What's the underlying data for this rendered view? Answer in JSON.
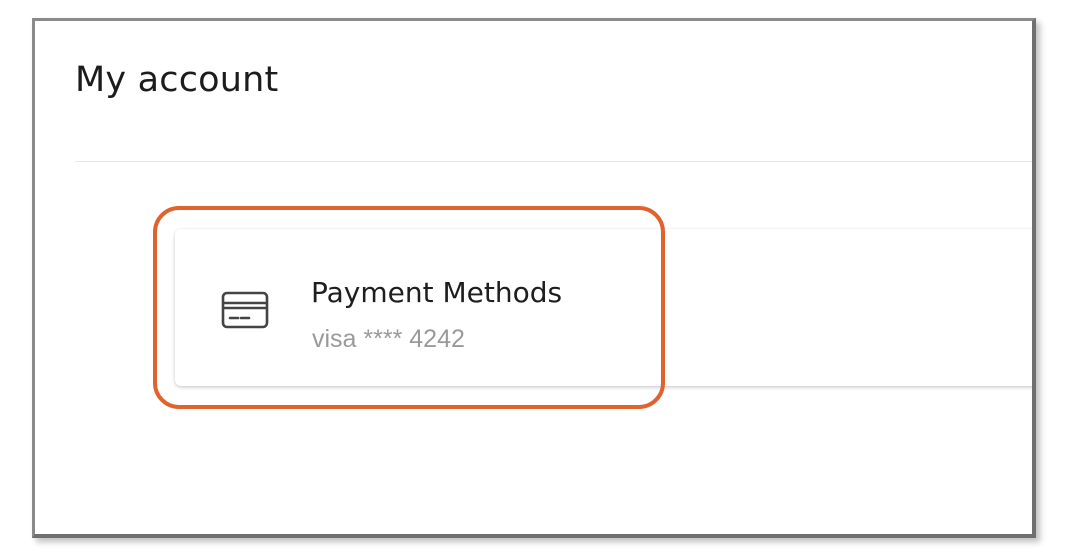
{
  "header": {
    "title": "My account"
  },
  "payment_card": {
    "title": "Payment Methods",
    "subtitle": "visa **** 4242",
    "icon": "credit-card-icon"
  },
  "colors": {
    "highlight": "#e0622f",
    "title_text": "#1c1c1c",
    "subtitle_text": "#9a9a9a"
  }
}
